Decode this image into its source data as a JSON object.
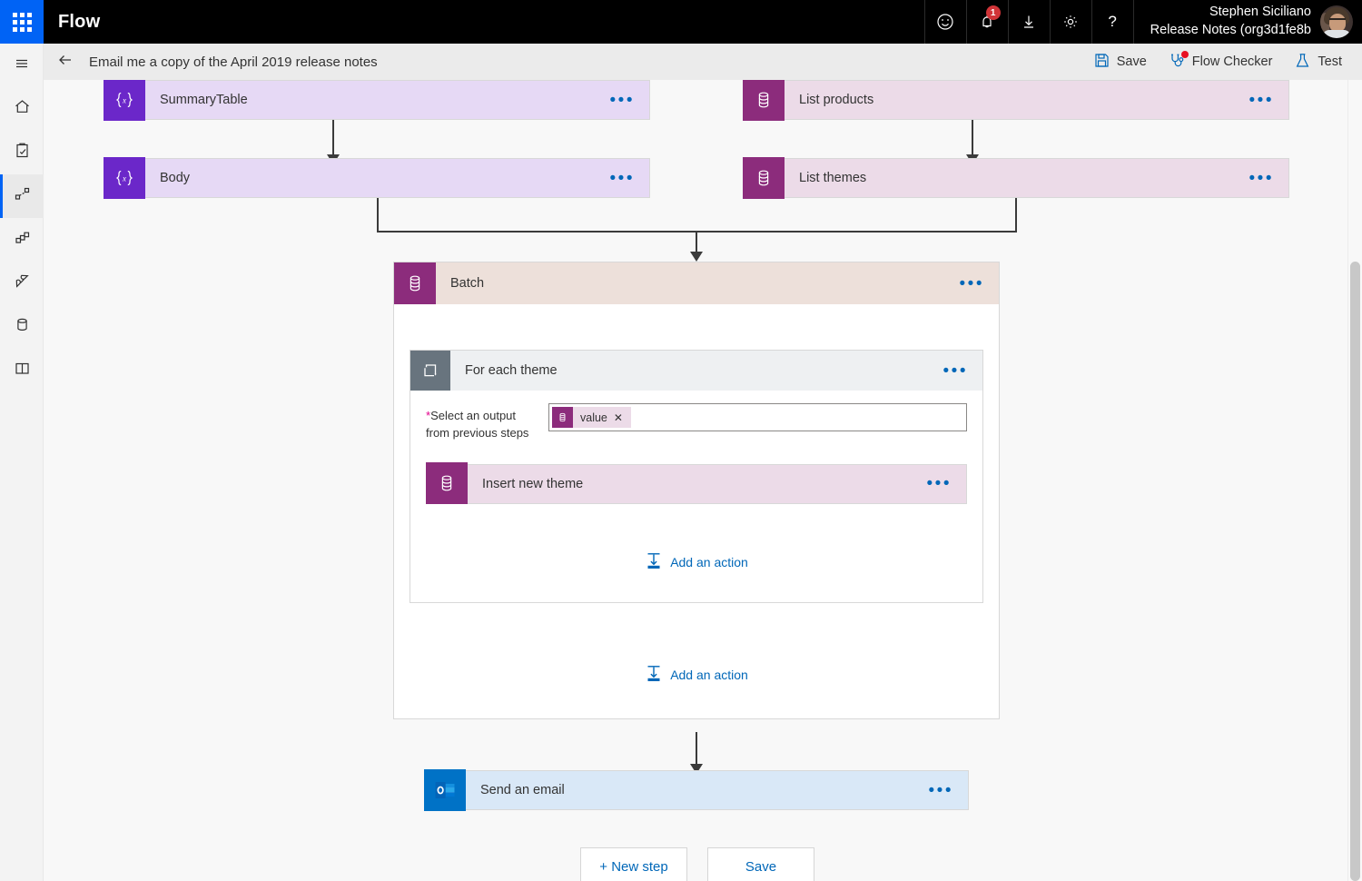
{
  "topbar": {
    "waffle_icon": "app-launcher-icon",
    "app_title": "Flow",
    "actions": [
      {
        "name": "feedback-icon",
        "glyph": "smiley"
      },
      {
        "name": "notifications-icon",
        "glyph": "bell",
        "badge": "1"
      },
      {
        "name": "download-icon",
        "glyph": "download"
      },
      {
        "name": "settings-icon",
        "glyph": "gear"
      },
      {
        "name": "help-icon",
        "glyph": "question"
      }
    ],
    "user": {
      "name": "Stephen Siciliano",
      "environment": "Release Notes (org3d1fe8b",
      "avatar_alt": "user-avatar"
    }
  },
  "commandbar": {
    "back_label": "back-arrow-icon",
    "flow_name": "Email me a copy of the April 2019 release notes",
    "save_label": "Save",
    "flow_checker_label": "Flow Checker",
    "test_label": "Test",
    "flow_checker_has_alert": true
  },
  "leftnav": {
    "items": [
      {
        "name": "sidebar-item-menu",
        "icon": "hamburger-icon",
        "label": "",
        "active": false
      },
      {
        "name": "sidebar-item-home",
        "icon": "home-icon",
        "label": "",
        "active": false
      },
      {
        "name": "sidebar-item-approvals",
        "icon": "clipboard-icon",
        "label": "",
        "active": false
      },
      {
        "name": "sidebar-item-flows",
        "icon": "flows-icon",
        "label": "",
        "active": true
      },
      {
        "name": "sidebar-item-business-process",
        "icon": "process-icon",
        "label": "",
        "active": false
      },
      {
        "name": "sidebar-item-connectors",
        "icon": "plug-icon",
        "label": "",
        "active": false
      },
      {
        "name": "sidebar-item-data",
        "icon": "database-icon",
        "label": "",
        "active": false
      },
      {
        "name": "sidebar-item-learn",
        "icon": "book-icon",
        "label": "",
        "active": false
      }
    ]
  },
  "designer": {
    "cards": {
      "summary_table": {
        "title": "SummaryTable",
        "icon": "variable-icon",
        "menu": "•••"
      },
      "body": {
        "title": "Body",
        "icon": "variable-icon",
        "menu": "•••"
      },
      "list_products": {
        "title": "List products",
        "icon": "cds-database-icon",
        "menu": "•••"
      },
      "list_themes": {
        "title": "List themes",
        "icon": "cds-database-icon",
        "menu": "•••"
      },
      "send_email": {
        "title": "Send an email",
        "icon": "outlook-icon",
        "menu": "•••"
      }
    },
    "scope": {
      "title": "Batch",
      "icon": "cds-database-icon",
      "menu": "•••",
      "add_action_label": "Add an action"
    },
    "foreach": {
      "title": "For each theme",
      "icon": "loop-icon",
      "menu": "•••",
      "field_label_line1": "Select an output",
      "field_label_line2": "from previous steps",
      "required_marker": "*",
      "token": {
        "label": "value",
        "remove": "✕",
        "icon": "cds-database-icon"
      },
      "inner_card": {
        "title": "Insert new theme",
        "icon": "cds-database-icon",
        "menu": "•••"
      },
      "add_action_label": "Add an action"
    },
    "footer": {
      "new_step_label": "+ New step",
      "save_label": "Save"
    }
  },
  "colors": {
    "accent_blue": "#0063f5",
    "link_blue": "#0067b8",
    "variable_purple": "#6b27c9",
    "cds_magenta": "#8c2c7c",
    "loop_slate": "#68747e",
    "outlook_blue": "#0072c6",
    "scope_header": "#ede0da",
    "card_variable_bg": "#e6d9f5",
    "card_cds_bg": "#ecdbe8",
    "card_outlook_bg": "#d9e8f7",
    "alert_red": "#d13438"
  }
}
